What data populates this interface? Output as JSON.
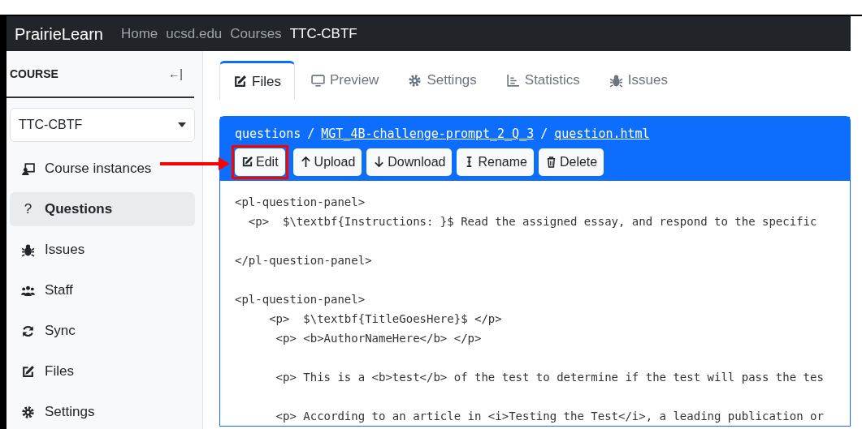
{
  "navbar": {
    "brand": "PrairieLearn",
    "links": [
      {
        "label": "Home",
        "selected": false
      },
      {
        "label": "ucsd.edu",
        "selected": false
      },
      {
        "label": "Courses",
        "selected": false
      },
      {
        "label": "TTC-CBTF",
        "selected": true
      }
    ]
  },
  "sidebar": {
    "heading": "COURSE",
    "collapse_icon": "←|",
    "course_select": "TTC-CBTF",
    "items": [
      {
        "label": "Course instances",
        "selected": false
      },
      {
        "glyph": "?",
        "label": "Questions",
        "selected": true
      },
      {
        "label": "Issues",
        "selected": false
      },
      {
        "label": "Staff",
        "selected": false
      },
      {
        "label": "Sync",
        "selected": false
      },
      {
        "label": "Files",
        "selected": false
      },
      {
        "label": "Settings",
        "selected": false
      }
    ]
  },
  "tabs": [
    {
      "label": "Files",
      "selected": true
    },
    {
      "label": "Preview",
      "selected": false
    },
    {
      "label": "Settings",
      "selected": false
    },
    {
      "label": "Statistics",
      "selected": false
    },
    {
      "label": "Issues",
      "selected": false
    }
  ],
  "file_path": [
    {
      "label": "questions",
      "kind": "text"
    },
    {
      "label": "/",
      "kind": "separator"
    },
    {
      "label": "MGT_4B-challenge-prompt_2_Q_3",
      "kind": "link"
    },
    {
      "label": "/",
      "kind": "separator"
    },
    {
      "label": "question.html",
      "kind": "link"
    }
  ],
  "file_buttons": [
    {
      "label": "Edit",
      "highlighted": true
    },
    {
      "label": "Upload",
      "highlighted": false
    },
    {
      "label": "Download",
      "highlighted": false
    },
    {
      "label": "Rename",
      "highlighted": false
    },
    {
      "label": "Delete",
      "highlighted": false
    }
  ],
  "code_blocks": [
    [
      "<pl-question-panel>",
      "  <p>  $\\textbf{Instructions: }$ Read the assigned essay, and respond to the specific"
    ],
    [
      "</pl-question-panel>"
    ],
    [
      "<pl-question-panel>",
      "     <p>  $\\textbf{TitleGoesHere}$ </p>",
      "      <p> <b>AuthorNameHere</b> </p>"
    ],
    [
      "      <p> This is a <b>test</b> of the test to determine if the test will pass the tes"
    ],
    [
      "      <p> According to an article in <i>Testing the Test</i>, a leading publication or"
    ]
  ]
}
